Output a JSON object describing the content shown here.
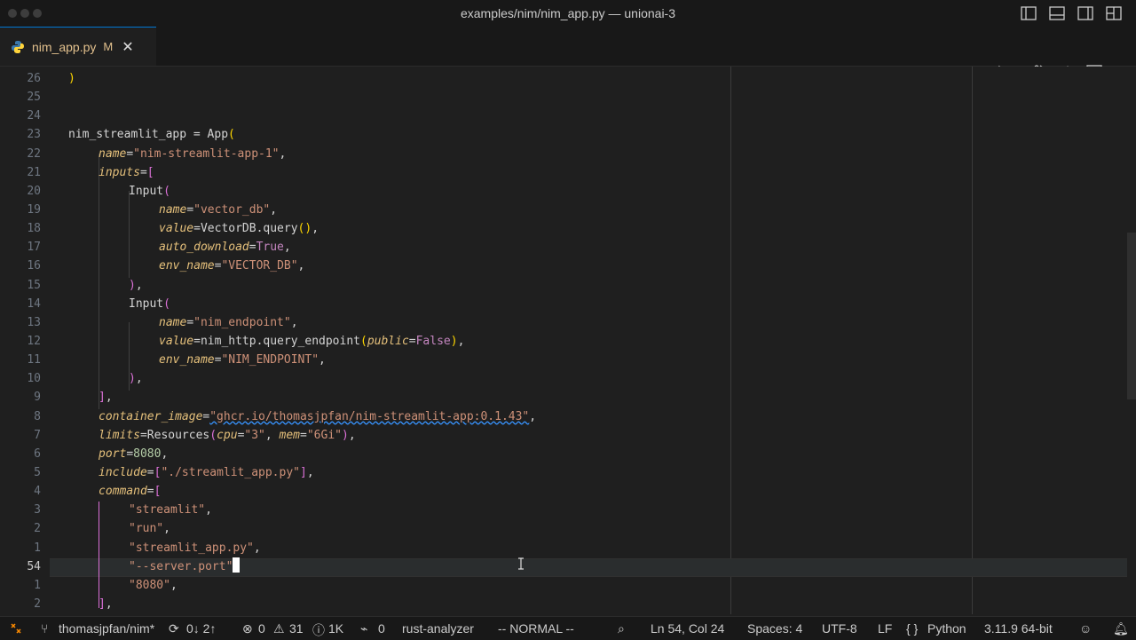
{
  "window": {
    "title": "examples/nim/nim_app.py — unionai-3"
  },
  "tab": {
    "filename": "nim_app.py",
    "status": "M",
    "close": "✕"
  },
  "editor": {
    "lines": [
      {
        "n": "26",
        "tokens": [
          [
            "t-brk",
            ")"
          ]
        ],
        "indent": 0
      },
      {
        "n": "25",
        "tokens": [],
        "indent": 0
      },
      {
        "n": "24",
        "tokens": [],
        "indent": 0
      },
      {
        "n": "23",
        "tokens": [
          [
            "t-id",
            "nim_streamlit_app "
          ],
          [
            "t-op",
            "= "
          ],
          [
            "t-id",
            "App"
          ],
          [
            "t-brk",
            "("
          ]
        ],
        "indent": 0
      },
      {
        "n": "22",
        "tokens": [
          [
            "t-kw",
            "name"
          ],
          [
            "t-op",
            "="
          ],
          [
            "t-str",
            "\"nim-streamlit-app-1\""
          ],
          [
            "t-op",
            ","
          ]
        ],
        "indent": 1
      },
      {
        "n": "21",
        "tokens": [
          [
            "t-kw",
            "inputs"
          ],
          [
            "t-op",
            "="
          ],
          [
            "t-par",
            "["
          ]
        ],
        "indent": 1
      },
      {
        "n": "20",
        "tokens": [
          [
            "t-id",
            "Input"
          ],
          [
            "t-par",
            "("
          ]
        ],
        "indent": 2
      },
      {
        "n": "19",
        "tokens": [
          [
            "t-kw",
            "name"
          ],
          [
            "t-op",
            "="
          ],
          [
            "t-str",
            "\"vector_db\""
          ],
          [
            "t-op",
            ","
          ]
        ],
        "indent": 3
      },
      {
        "n": "18",
        "tokens": [
          [
            "t-kw",
            "value"
          ],
          [
            "t-op",
            "="
          ],
          [
            "t-id",
            "VectorDB.query"
          ],
          [
            "t-brk",
            "()"
          ],
          [
            "t-op",
            ","
          ]
        ],
        "indent": 3
      },
      {
        "n": "17",
        "tokens": [
          [
            "t-kw",
            "auto_download"
          ],
          [
            "t-op",
            "="
          ],
          [
            "t-bool",
            "True"
          ],
          [
            "t-op",
            ","
          ]
        ],
        "indent": 3
      },
      {
        "n": "16",
        "tokens": [
          [
            "t-kw",
            "env_name"
          ],
          [
            "t-op",
            "="
          ],
          [
            "t-str",
            "\"VECTOR_DB\""
          ],
          [
            "t-op",
            ","
          ]
        ],
        "indent": 3
      },
      {
        "n": "15",
        "tokens": [
          [
            "t-par",
            ")"
          ],
          [
            "t-op",
            ","
          ]
        ],
        "indent": 2
      },
      {
        "n": "14",
        "tokens": [
          [
            "t-id",
            "Input"
          ],
          [
            "t-par",
            "("
          ]
        ],
        "indent": 2
      },
      {
        "n": "13",
        "tokens": [
          [
            "t-kw",
            "name"
          ],
          [
            "t-op",
            "="
          ],
          [
            "t-str",
            "\"nim_endpoint\""
          ],
          [
            "t-op",
            ","
          ]
        ],
        "indent": 3
      },
      {
        "n": "12",
        "tokens": [
          [
            "t-kw",
            "value"
          ],
          [
            "t-op",
            "="
          ],
          [
            "t-id",
            "nim_http.query_endpoint"
          ],
          [
            "t-brk",
            "("
          ],
          [
            "t-kw",
            "public"
          ],
          [
            "t-op",
            "="
          ],
          [
            "t-bool",
            "False"
          ],
          [
            "t-brk",
            ")"
          ],
          [
            "t-op",
            ","
          ]
        ],
        "indent": 3
      },
      {
        "n": "11",
        "tokens": [
          [
            "t-kw",
            "env_name"
          ],
          [
            "t-op",
            "="
          ],
          [
            "t-str",
            "\"NIM_ENDPOINT\""
          ],
          [
            "t-op",
            ","
          ]
        ],
        "indent": 3
      },
      {
        "n": "10",
        "tokens": [
          [
            "t-par",
            ")"
          ],
          [
            "t-op",
            ","
          ]
        ],
        "indent": 2
      },
      {
        "n": "9",
        "tokens": [
          [
            "t-par",
            "]"
          ],
          [
            "t-op",
            ","
          ]
        ],
        "indent": 1
      },
      {
        "n": "8",
        "tokens": [
          [
            "t-kw",
            "container_image"
          ],
          [
            "t-op",
            "="
          ],
          [
            "t-str",
            "\"ghcr.io/thomasjpfan/nim-streamlit-app:0.1.43\""
          ],
          [
            "t-op",
            ","
          ]
        ],
        "indent": 1
      },
      {
        "n": "7",
        "tokens": [
          [
            "t-kw",
            "limits"
          ],
          [
            "t-op",
            "="
          ],
          [
            "t-id",
            "Resources"
          ],
          [
            "t-par",
            "("
          ],
          [
            "t-kw",
            "cpu"
          ],
          [
            "t-op",
            "="
          ],
          [
            "t-str",
            "\"3\""
          ],
          [
            "t-op",
            ", "
          ],
          [
            "t-kw",
            "mem"
          ],
          [
            "t-op",
            "="
          ],
          [
            "t-str",
            "\"6Gi\""
          ],
          [
            "t-par",
            ")"
          ],
          [
            "t-op",
            ","
          ]
        ],
        "indent": 1
      },
      {
        "n": "6",
        "tokens": [
          [
            "t-kw",
            "port"
          ],
          [
            "t-op",
            "="
          ],
          [
            "t-num",
            "8080"
          ],
          [
            "t-op",
            ","
          ]
        ],
        "indent": 1
      },
      {
        "n": "5",
        "tokens": [
          [
            "t-kw",
            "include"
          ],
          [
            "t-op",
            "="
          ],
          [
            "t-par",
            "["
          ],
          [
            "t-str",
            "\"./streamlit_app.py\""
          ],
          [
            "t-par",
            "]"
          ],
          [
            "t-op",
            ","
          ]
        ],
        "indent": 1
      },
      {
        "n": "4",
        "tokens": [
          [
            "t-kw",
            "command"
          ],
          [
            "t-op",
            "="
          ],
          [
            "t-par",
            "["
          ]
        ],
        "indent": 1
      },
      {
        "n": "3",
        "tokens": [
          [
            "t-str",
            "\"streamlit\""
          ],
          [
            "t-op",
            ","
          ]
        ],
        "indent": 2
      },
      {
        "n": "2",
        "tokens": [
          [
            "t-str",
            "\"run\""
          ],
          [
            "t-op",
            ","
          ]
        ],
        "indent": 2
      },
      {
        "n": "1",
        "tokens": [
          [
            "t-str",
            "\"streamlit_app.py\""
          ],
          [
            "t-op",
            ","
          ]
        ],
        "indent": 2
      },
      {
        "n": "54",
        "tokens": [
          [
            "t-str",
            "\"--server.port\""
          ]
        ],
        "indent": 2,
        "current": true
      },
      {
        "n": "1",
        "tokens": [
          [
            "t-str",
            "\"8080\""
          ],
          [
            "t-op",
            ","
          ]
        ],
        "indent": 2
      },
      {
        "n": "2",
        "tokens": [
          [
            "t-par",
            "]"
          ],
          [
            "t-op",
            ","
          ]
        ],
        "indent": 1
      }
    ]
  },
  "status": {
    "branch": "thomasjpfan/nim*",
    "sync": "0↓ 2↑",
    "errors": "0",
    "warnings": "31",
    "info": "1K",
    "ports": "0",
    "analyzer": "rust-analyzer",
    "vim_mode": "-- NORMAL --",
    "position": "Ln 54, Col 24",
    "spaces": "Spaces: 4",
    "encoding": "UTF-8",
    "eol": "LF",
    "language": "Python",
    "interpreter": "3.11.9 64-bit"
  }
}
